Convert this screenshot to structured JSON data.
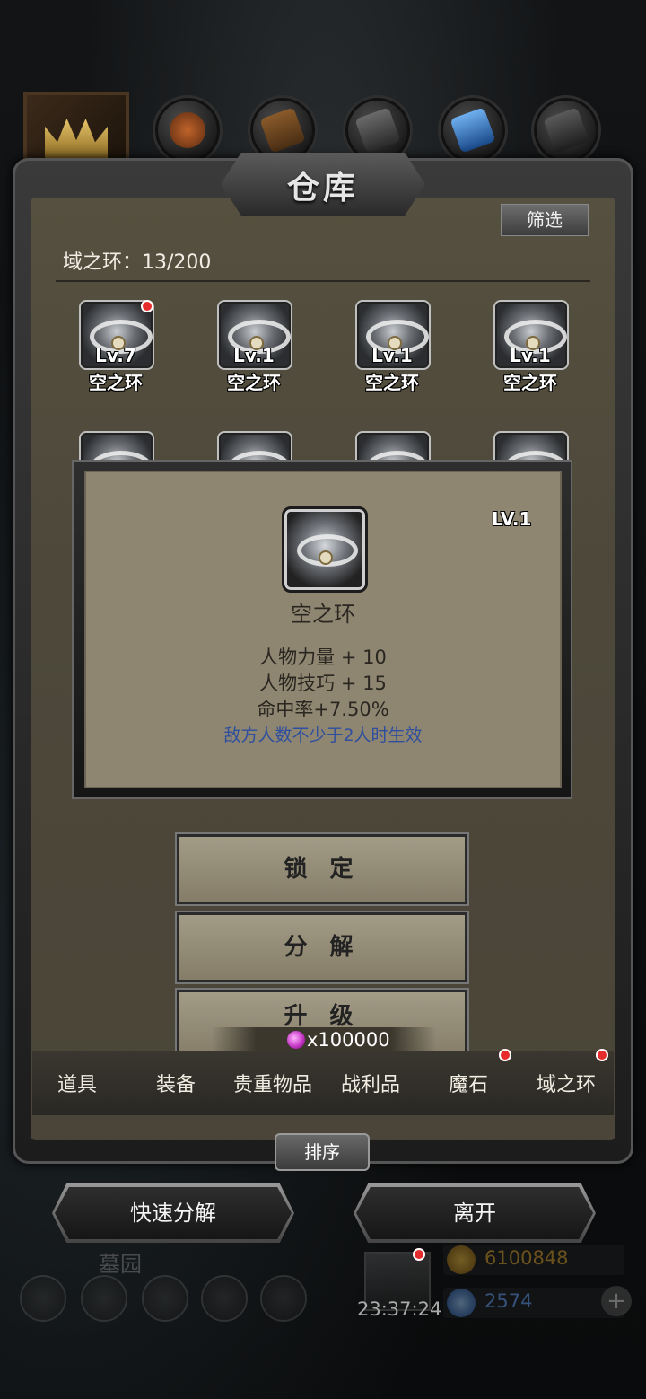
{
  "header": {
    "title": "仓库",
    "filter_label": "筛选",
    "category_icons": [
      "crown-icon",
      "ball-icon",
      "wood-icon",
      "stone-icon",
      "crystal-icon",
      "ore-icon"
    ]
  },
  "inventory": {
    "label": "域之环：13/200",
    "items": [
      {
        "level": "Lv.7",
        "name": "空之环",
        "new": true
      },
      {
        "level": "Lv.1",
        "name": "空之环",
        "new": false
      },
      {
        "level": "Lv.1",
        "name": "空之环",
        "new": false
      },
      {
        "level": "Lv.1",
        "name": "空之环",
        "new": false
      }
    ]
  },
  "detail": {
    "level": "LV.1",
    "name": "空之环",
    "stats": [
      "人物力量 + 10",
      "人物技巧 + 15",
      "命中率+7.50%"
    ],
    "condition": "敌方人数不少于2人时生效"
  },
  "actions": {
    "lock": "锁 定",
    "decompose": "分 解",
    "upgrade": "升 级",
    "upgrade_cost": "x100000"
  },
  "tabs": [
    "道具",
    "装备",
    "贵重物品",
    "战利品",
    "魔石",
    "域之环"
  ],
  "sort_label": "排序",
  "bottom": {
    "quick_decompose": "快速分解",
    "leave": "离开",
    "location": "墓园",
    "clock": "23:37:24",
    "gold": "6100848",
    "gems": "2574"
  },
  "colors": {
    "panel": "#4d483a",
    "popup": "#8f8672",
    "condition_text": "#2e4e9e",
    "badge": "#e52b2b"
  }
}
